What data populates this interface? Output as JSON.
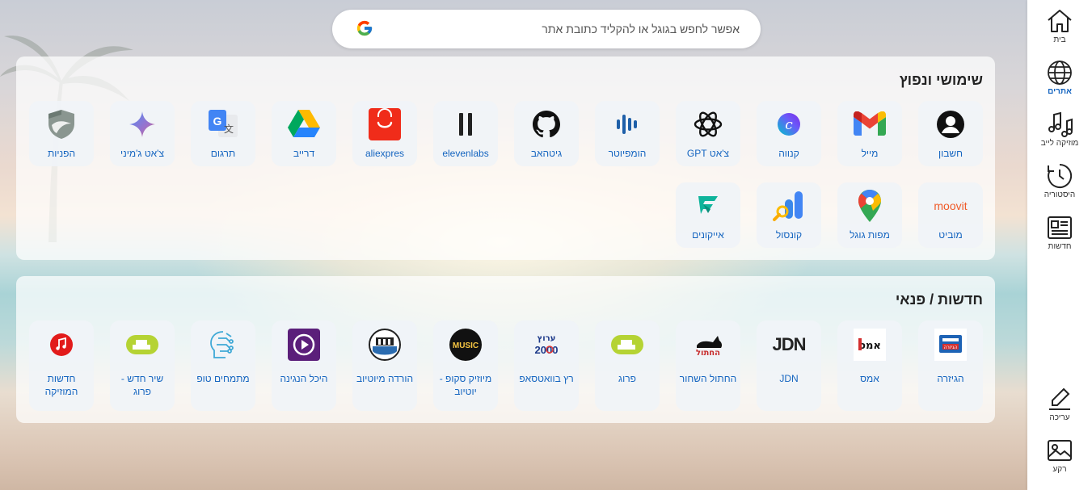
{
  "search": {
    "placeholder": "אפשר לחפש בגוגל או להקליד כתובת אתר",
    "icon": "google-icon"
  },
  "sections": [
    {
      "title": "שימושי ונפוץ",
      "tiles": [
        {
          "label": "חשבון",
          "icon": "account-icon"
        },
        {
          "label": "מייל",
          "icon": "gmail-icon"
        },
        {
          "label": "קנווה",
          "icon": "canva-icon"
        },
        {
          "label": "צ'אט GPT",
          "icon": "chatgpt-icon"
        },
        {
          "label": "הומפיוטר",
          "icon": "humpiuter-icon"
        },
        {
          "label": "גיטהאב",
          "icon": "github-icon"
        },
        {
          "label": "elevenlabs",
          "icon": "elevenlabs-icon"
        },
        {
          "label": "aliexpres",
          "icon": "aliexpress-icon"
        },
        {
          "label": "דרייב",
          "icon": "google-drive-icon"
        },
        {
          "label": "תרגום",
          "icon": "google-translate-icon"
        },
        {
          "label": "צ'אט ג'מיני",
          "icon": "gemini-icon"
        },
        {
          "label": "הפניות",
          "icon": "shield-icon"
        },
        {
          "label": "מוביט",
          "icon": "moovit-icon",
          "logo_text": "moovit"
        },
        {
          "label": "מפות גוגל",
          "icon": "google-maps-icon"
        },
        {
          "label": "קונסול",
          "icon": "search-console-icon"
        },
        {
          "label": "אייקונים",
          "icon": "flaticon-icon"
        }
      ]
    },
    {
      "title": "חדשות / פנאי",
      "tiles": [
        {
          "label": "הגיזרה",
          "icon": "hagizra-icon"
        },
        {
          "label": "אמס",
          "icon": "ems-icon",
          "logo_text": "אמס"
        },
        {
          "label": "JDN",
          "icon": "jdn-icon",
          "logo_text": "JDN"
        },
        {
          "label": "החתול השחור",
          "icon": "black-cat-icon",
          "logo_text": "החתול"
        },
        {
          "label": "פרוג",
          "icon": "frog-icon"
        },
        {
          "label": "רץ בוואטסאפ",
          "icon": "channel-2000-icon",
          "logo_text": "ערוץ"
        },
        {
          "label": "מיוזיק סקופ - יוטיוב",
          "icon": "music-scoop-icon",
          "logo_text": "MUSIC"
        },
        {
          "label": "הורדה מיוטיוב",
          "icon": "download-youtube-icon"
        },
        {
          "label": "היכל הנגינה",
          "icon": "play-button-icon"
        },
        {
          "label": "מתמחים טופ",
          "icon": "circuit-head-icon"
        },
        {
          "label": "שיר חדש - פרוג",
          "icon": "frog-icon"
        },
        {
          "label": "חדשות המוזיקה",
          "icon": "music-note-icon"
        }
      ]
    }
  ],
  "sidebar": {
    "top": [
      {
        "label": "בית",
        "icon": "home-icon"
      },
      {
        "label": "אתרים",
        "icon": "globe-icon",
        "active": true
      },
      {
        "label": "מוזיקה לייב",
        "icon": "music-notes-icon"
      },
      {
        "label": "היסטוריה",
        "icon": "history-icon"
      },
      {
        "label": "חדשות",
        "icon": "newspaper-icon"
      }
    ],
    "bottom": [
      {
        "label": "עריכה",
        "icon": "edit-icon"
      },
      {
        "label": "רקע",
        "icon": "image-icon"
      }
    ]
  },
  "colors": {
    "link": "#1565c0",
    "active": "#1565c0"
  }
}
